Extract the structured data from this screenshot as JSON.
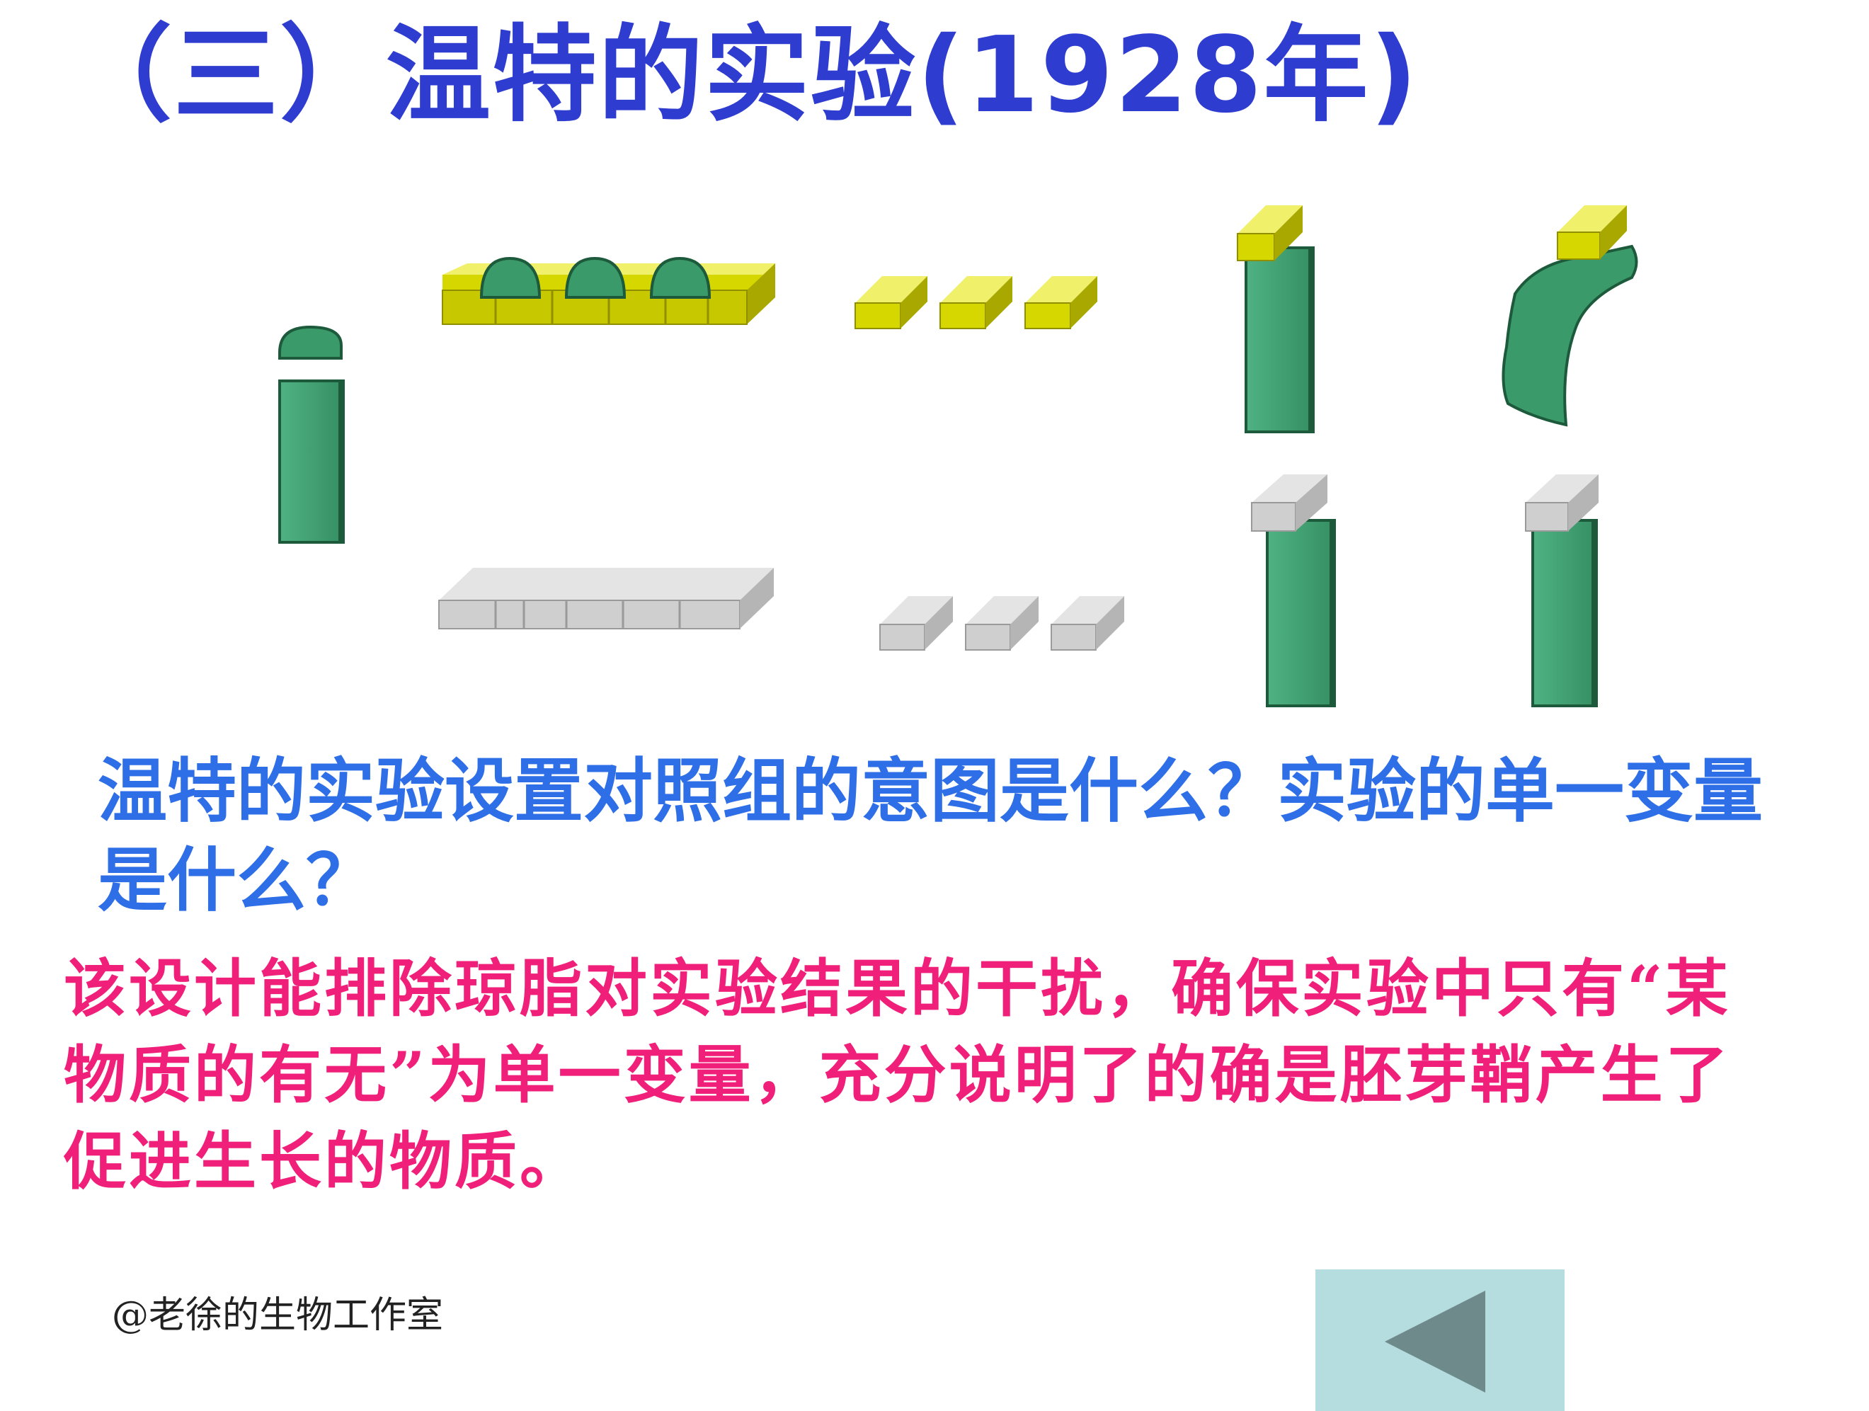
{
  "slide": {
    "title": "（三）温特的实验(1928年)",
    "question": "温特的实验设置对照组的意图是什么？实验的单一变量是什么？",
    "answer": "该设计能排除琼脂对实验结果的干扰，确保实验中只有“某物质的有无”为单一变量，充分说明了的确是胚芽鞘产生了促进生长的物质。",
    "credit": "@老徐的生物工作室"
  },
  "navigation": {
    "back_icon": "back-triangle-icon"
  },
  "colors": {
    "title": "#2e3dd0",
    "question": "#2e6fe8",
    "answer": "#f0207a",
    "coleoptile": "#3a9a6a",
    "agar_treated": "#d7d700",
    "agar_control": "#c8c8c8",
    "nav_bg": "#b5dde0",
    "nav_arrow": "#6e8a8a"
  }
}
